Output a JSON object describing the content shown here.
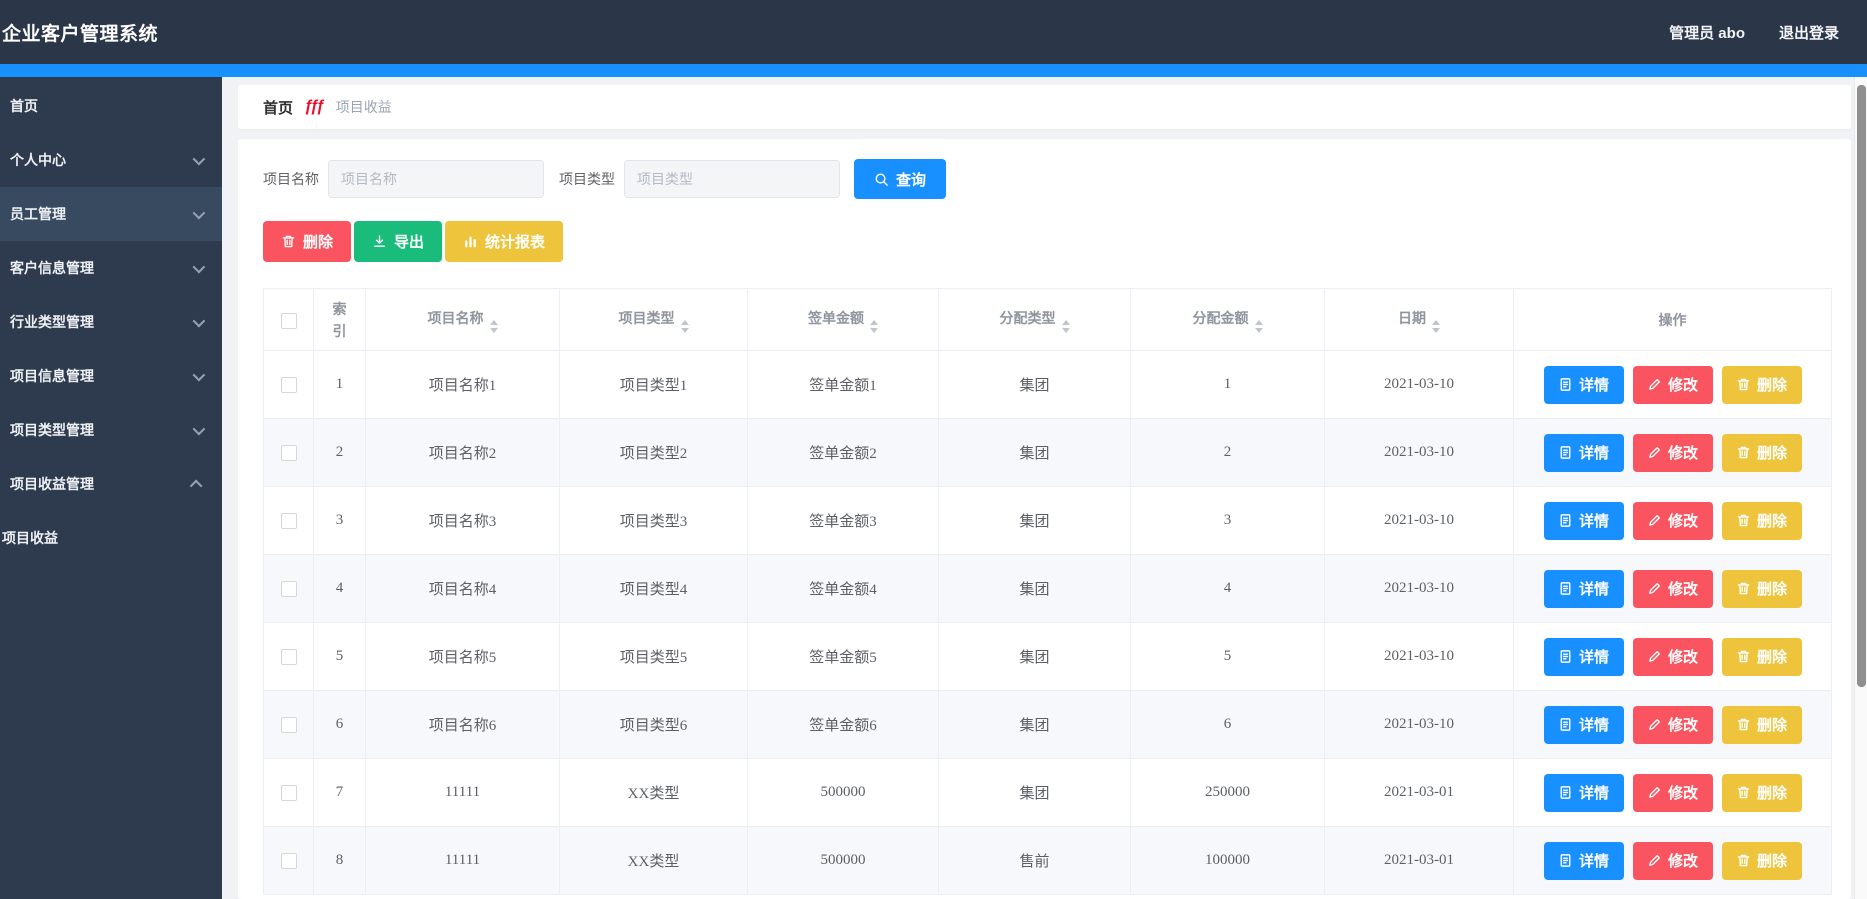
{
  "topbar": {
    "title": "企业客户管理系统",
    "user": "管理员 abo",
    "logout": "退出登录"
  },
  "sidebar": {
    "items": [
      {
        "key": "home",
        "label": "首页",
        "arrow": "none",
        "active": false,
        "sub": false
      },
      {
        "key": "personal-center",
        "label": "个人中心",
        "arrow": "down",
        "active": false,
        "sub": false
      },
      {
        "key": "employee-mgmt",
        "label": "员工管理",
        "arrow": "down",
        "active": true,
        "sub": false
      },
      {
        "key": "customer-info-mgmt",
        "label": "客户信息管理",
        "arrow": "down",
        "active": false,
        "sub": false
      },
      {
        "key": "industry-type-mgmt",
        "label": "行业类型管理",
        "arrow": "down",
        "active": false,
        "sub": false
      },
      {
        "key": "project-info-mgmt",
        "label": "项目信息管理",
        "arrow": "down",
        "active": false,
        "sub": false
      },
      {
        "key": "project-type-mgmt",
        "label": "项目类型管理",
        "arrow": "down",
        "active": false,
        "sub": false
      },
      {
        "key": "project-income-mgmt",
        "label": "项目收益管理",
        "arrow": "up",
        "active": false,
        "sub": false
      },
      {
        "key": "project-income",
        "label": "项目收益",
        "arrow": "none",
        "active": false,
        "sub": true
      }
    ]
  },
  "breadcrumb": {
    "home": "首页",
    "current": "项目收益",
    "separator_glyph": "ƒƒƒ"
  },
  "filters": {
    "name_label": "项目名称",
    "name_placeholder": "项目名称",
    "name_value": "",
    "type_label": "项目类型",
    "type_placeholder": "项目类型",
    "type_value": "",
    "search_label": "查询"
  },
  "toolbar": [
    {
      "key": "delete",
      "label": "删除",
      "icon": "trash",
      "color": "#f9545f"
    },
    {
      "key": "export",
      "label": "导出",
      "icon": "download",
      "color": "#1abc7c"
    },
    {
      "key": "report",
      "label": "统计报表",
      "icon": "chart",
      "color": "#eec43d"
    }
  ],
  "table": {
    "columns": [
      {
        "label": "索引",
        "sortable": false
      },
      {
        "label": "项目名称",
        "sortable": true
      },
      {
        "label": "项目类型",
        "sortable": true
      },
      {
        "label": "签单金额",
        "sortable": true
      },
      {
        "label": "分配类型",
        "sortable": true
      },
      {
        "label": "分配金额",
        "sortable": true
      },
      {
        "label": "日期",
        "sortable": true
      },
      {
        "label": "操作",
        "sortable": false
      }
    ],
    "rows": [
      {
        "cells": [
          "1",
          "项目名称1",
          "项目类型1",
          "签单金额1",
          "集团",
          "1",
          "2021-03-10"
        ]
      },
      {
        "cells": [
          "2",
          "项目名称2",
          "项目类型2",
          "签单金额2",
          "集团",
          "2",
          "2021-03-10"
        ]
      },
      {
        "cells": [
          "3",
          "项目名称3",
          "项目类型3",
          "签单金额3",
          "集团",
          "3",
          "2021-03-10"
        ]
      },
      {
        "cells": [
          "4",
          "项目名称4",
          "项目类型4",
          "签单金额4",
          "集团",
          "4",
          "2021-03-10"
        ]
      },
      {
        "cells": [
          "5",
          "项目名称5",
          "项目类型5",
          "签单金额5",
          "集团",
          "5",
          "2021-03-10"
        ]
      },
      {
        "cells": [
          "6",
          "项目名称6",
          "项目类型6",
          "签单金额6",
          "集团",
          "6",
          "2021-03-10"
        ]
      },
      {
        "cells": [
          "7",
          "11111",
          "XX类型",
          "500000",
          "集团",
          "250000",
          "2021-03-01"
        ]
      },
      {
        "cells": [
          "8",
          "11111",
          "XX类型",
          "500000",
          "售前",
          "100000",
          "2021-03-01"
        ]
      }
    ],
    "row_actions": [
      {
        "key": "detail",
        "label": "详情",
        "icon": "doc",
        "color": "#1890ff"
      },
      {
        "key": "edit",
        "label": "修改",
        "icon": "pencil",
        "color": "#f9545f"
      },
      {
        "key": "delete",
        "label": "删除",
        "icon": "trash",
        "color": "#eec43d"
      }
    ]
  },
  "colors": {
    "topbar_bg": "#2b3648",
    "sidebar_bg": "#2e3a4d",
    "sidebar_active_bg": "#374a60",
    "accent_blue": "#1890ff",
    "danger_red": "#f9545f",
    "success_green": "#1abc7c",
    "warning_yellow": "#eec43d",
    "breadcrumb_icon_red": "#e8112d",
    "content_bg": "#f0f2f5",
    "table_border": "#ebeef5",
    "stripe_row": "#f7f8fb"
  }
}
